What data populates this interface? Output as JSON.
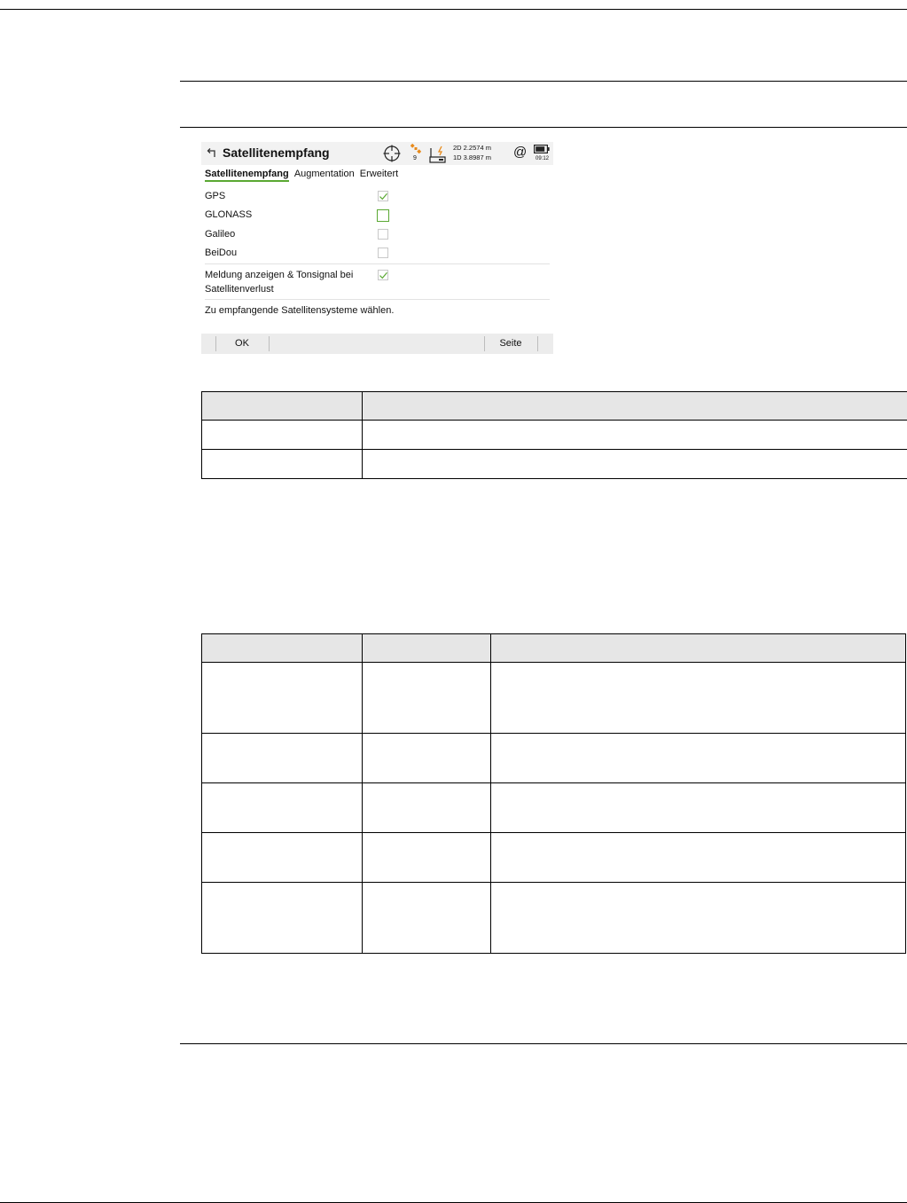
{
  "screen": {
    "title": "Satellitenempfang",
    "status": {
      "satellite_count": "9",
      "quality_2d": "2D 2.2574 m",
      "quality_1d": "1D 3.8987 m",
      "at_symbol": "@",
      "time": "09:12"
    },
    "tabs": [
      {
        "label": "Satellitenempfang",
        "active": true
      },
      {
        "label": "Augmentation",
        "active": false
      },
      {
        "label": "Erweitert",
        "active": false
      }
    ],
    "systems": [
      {
        "label": "GPS",
        "checked": true
      },
      {
        "label": "GLONASS",
        "checked": false
      },
      {
        "label": "Galileo",
        "checked": false
      },
      {
        "label": "BeiDou",
        "checked": false
      }
    ],
    "alert": {
      "label_line1": "Meldung anzeigen & Tonsignal bei",
      "label_line2": "Satellitenverlust",
      "checked": true
    },
    "hint": "Zu empfangende Satellitensysteme wählen.",
    "softkeys": {
      "ok": "OK",
      "page": "Seite"
    },
    "colors": {
      "accent": "#5aa832",
      "sat_icon": "#e88a1a"
    }
  },
  "icons": [
    "back-icon",
    "crosshair-icon",
    "satellite-icon",
    "radio-icon",
    "battery-icon"
  ]
}
